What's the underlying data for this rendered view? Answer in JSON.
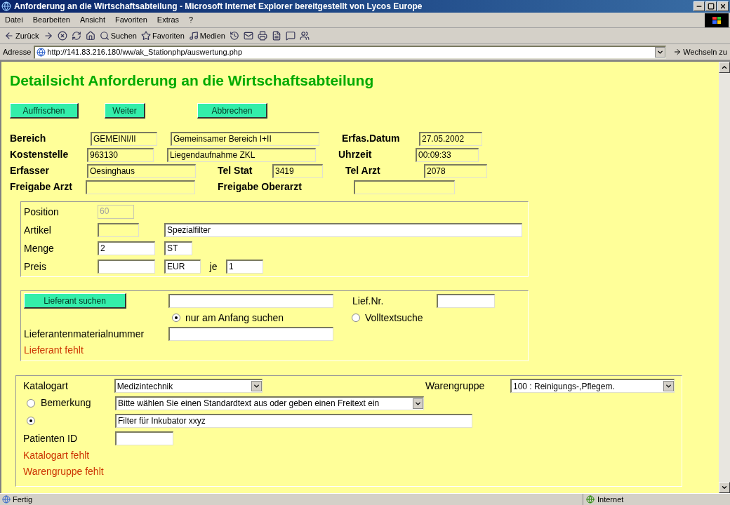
{
  "window": {
    "title": "Anforderung an die Wirtschaftsabteilung - Microsoft Internet Explorer bereitgestellt von Lycos Europe"
  },
  "menu": [
    "Datei",
    "Bearbeiten",
    "Ansicht",
    "Favoriten",
    "Extras",
    "?"
  ],
  "toolbar": [
    {
      "kind": "back",
      "label": "Zurück"
    },
    {
      "kind": "forward"
    },
    {
      "kind": "stop"
    },
    {
      "kind": "refresh"
    },
    {
      "kind": "home"
    },
    {
      "kind": "search",
      "label": "Suchen"
    },
    {
      "kind": "favorites",
      "label": "Favoriten"
    },
    {
      "kind": "media",
      "label": "Medien"
    },
    {
      "kind": "history"
    },
    {
      "kind": "mail"
    },
    {
      "kind": "print"
    },
    {
      "kind": "edit"
    },
    {
      "kind": "discuss"
    },
    {
      "kind": "messenger"
    }
  ],
  "address_bar": {
    "label": "Adresse",
    "url": "http://141.83.216.180/ww/ak_Stationphp/auswertung.php",
    "go": "Wechseln zu"
  },
  "page": {
    "heading": "Detailsicht Anforderung an die Wirtschaftsabteilung",
    "buttons": [
      "Auffrischen",
      "Weiter",
      "Abbrechen"
    ],
    "header_rows": [
      [
        {
          "kind": "label",
          "text": "Bereich"
        },
        {
          "kind": "field",
          "value": "GEMEINI/II"
        },
        {
          "kind": "field",
          "value": "Gemeinsamer Bereich I+II"
        },
        {
          "kind": "label",
          "text": "Erfas.Datum"
        },
        {
          "kind": "field",
          "value": "27.05.2002"
        }
      ],
      [
        {
          "kind": "label",
          "text": "Kostenstelle"
        },
        {
          "kind": "field",
          "value": "963130"
        },
        {
          "kind": "field",
          "value": "Liegendaufnahme ZKL"
        },
        {
          "kind": "label",
          "text": "Uhrzeit"
        },
        {
          "kind": "field",
          "value": "00:09:33"
        }
      ],
      [
        {
          "kind": "label",
          "text": "Erfasser"
        },
        {
          "kind": "field",
          "value": "Oesinghaus"
        },
        {
          "kind": "label",
          "text": "Tel Stat"
        },
        {
          "kind": "field",
          "value": "3419"
        },
        {
          "kind": "label",
          "text": "Tel Arzt"
        },
        {
          "kind": "field",
          "value": "2078"
        }
      ],
      [
        {
          "kind": "label",
          "text": "Freigabe Arzt"
        },
        {
          "kind": "field"
        },
        {
          "kind": "label",
          "text": "Freigabe Oberarzt"
        },
        {
          "kind": "field"
        }
      ]
    ],
    "position": [
      {
        "label": "Position",
        "fields": [
          {
            "value": "60",
            "editable": false,
            "disabled": true
          }
        ]
      },
      {
        "label": "Artikel",
        "fields": [
          {
            "editable": false,
            "disabled": false
          },
          {
            "value": "Spezialfilter",
            "editable": true,
            "disabled": false
          }
        ]
      },
      {
        "label": "Menge",
        "fields": [
          {
            "value": "2",
            "editable": true,
            "disabled": false
          },
          {
            "value": "ST",
            "editable": true,
            "disabled": false
          }
        ]
      },
      {
        "label": "Preis",
        "fields": [
          {
            "editable": true,
            "disabled": false
          },
          {
            "value": "EUR",
            "editable": true,
            "disabled": false
          },
          {
            "label": "je"
          },
          {
            "value": "1",
            "editable": true,
            "disabled": false
          }
        ]
      }
    ],
    "supplier": {
      "button": "Lieferant suchen",
      "lief_nr_label": "Lief.Nr.",
      "radios": [
        {
          "label": "nur am Anfang suchen",
          "selected": true
        },
        {
          "label": "Volltextsuche",
          "selected": false
        }
      ],
      "material_label": "Lieferantenmaterialnummer",
      "error": "Lieferant fehlt"
    },
    "catalog": {
      "katalogart_label": "Katalogart",
      "katalogart": "Medizintechnik",
      "warengruppe_label": "Warengruppe",
      "warengruppe": "100 : Reinigungs-,Pflegem.",
      "remark_options": [
        {
          "label": "Bemerkung",
          "kind": "select",
          "value": "Bitte wählen Sie einen Standardtext aus oder geben einen Freitext ein",
          "selected": false
        },
        {
          "kind": "text",
          "value": "Filter für Inkubator xxyz",
          "selected": true
        }
      ],
      "patient_label": "Patienten ID",
      "errors": [
        "Katalogart fehlt",
        "Warengruppe fehlt"
      ]
    }
  },
  "status_bar": {
    "text": "Fertig",
    "zone": "Internet"
  }
}
